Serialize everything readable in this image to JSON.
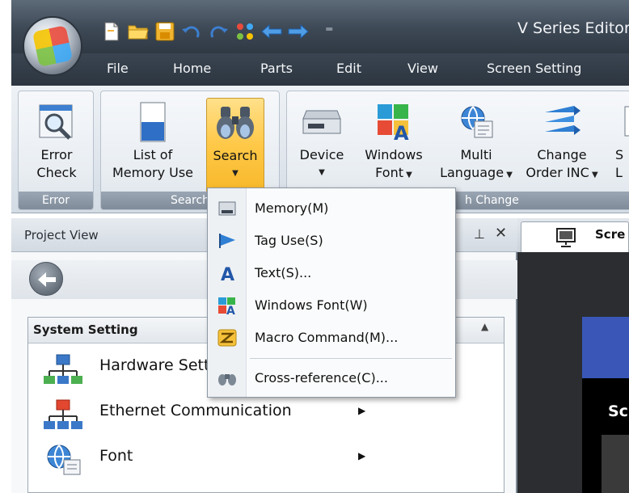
{
  "window": {
    "title": "V Series Editor"
  },
  "menu": [
    "File",
    "Home",
    "Parts",
    "Edit",
    "View",
    "Screen Setting"
  ],
  "ribbon": {
    "buttons": {
      "error_check": [
        "Error",
        "Check"
      ],
      "list_memory": [
        "List of",
        "Memory Use"
      ],
      "search": "Search",
      "device": "Device",
      "windows_font": [
        "Windows",
        "Font"
      ],
      "multi_language": [
        "Multi",
        "Language"
      ],
      "change_order": [
        "Change",
        "Order INC"
      ],
      "cut_s": "S",
      "cut_l": "L"
    },
    "groups": {
      "error": "Error",
      "search": "Search",
      "batch_change": "h Change"
    }
  },
  "dropdown": {
    "items": [
      "Memory(M)",
      "Tag Use(S)",
      "Text(S)...",
      "Windows Font(W)",
      "Macro Command(M)...",
      "Cross-reference(C)..."
    ]
  },
  "project_view": {
    "title": "Project View",
    "pin": "⊥",
    "close": "✕",
    "section_title": "System Setting",
    "items": [
      "Hardware Setting",
      "Ethernet Communication",
      "Font"
    ]
  },
  "screen": {
    "tab_label": "Scre",
    "canvas_label": "Sc"
  },
  "colors": {
    "titlebar": "#3d4855",
    "ribbon": "#e3e9ef",
    "active_button": "#ffc847",
    "canvas_blue": "#3a57b8"
  }
}
